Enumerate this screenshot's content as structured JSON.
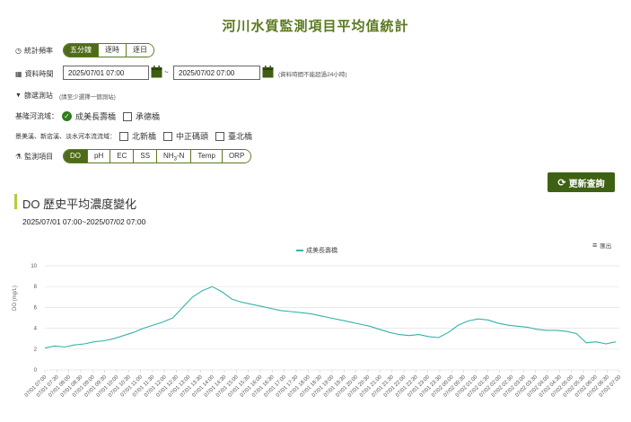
{
  "page": {
    "title": "河川水質監測項目平均值統計"
  },
  "frequency": {
    "label": "統計頻率",
    "options": [
      "五分鐘",
      "逐時",
      "逐日"
    ],
    "active": 0
  },
  "period": {
    "label": "資料時間",
    "start": "2025/07/01 07:00",
    "sep": "~",
    "end": "2025/07/02 07:00",
    "note": "(資料時間不能超過24小時)"
  },
  "stations": {
    "label": "篩選測站",
    "hint": "(請至少選擇一個測站)",
    "group1": {
      "label": "基隆河流域：",
      "items": [
        {
          "name": "成美長壽橋",
          "checked": true
        },
        {
          "name": "承德橋",
          "checked": false
        }
      ]
    },
    "group2": {
      "label": "景美溪、新店溪、淡水河本流流域：",
      "items": [
        {
          "name": "北新橋",
          "checked": false
        },
        {
          "name": "中正碼頭",
          "checked": false
        },
        {
          "name": "臺北橋",
          "checked": false
        }
      ]
    }
  },
  "items": {
    "label": "監測項目",
    "options": [
      "DO",
      "pH",
      "EC",
      "SS",
      "NH3-N",
      "Temp",
      "ORP"
    ],
    "active": 0
  },
  "refresh": {
    "label": "更新查詢"
  },
  "chart": {
    "title": "DO 歷史平均濃度變化",
    "range": "2025/07/01 07:00~2025/07/02 07:00",
    "export_label": "匯出"
  },
  "chart_data": {
    "type": "line",
    "ylabel": "DO (mg/L)",
    "ylim": [
      0,
      10
    ],
    "yticks": [
      0,
      2,
      4,
      6,
      8,
      10
    ],
    "legend": "top-center",
    "grid": true,
    "series": [
      {
        "name": "成美長壽橋",
        "color": "#34b3a8"
      }
    ],
    "x": [
      "07/01 07:00",
      "07/01 07:30",
      "07/01 08:00",
      "07/01 08:30",
      "07/01 09:00",
      "07/01 09:30",
      "07/01 10:00",
      "07/01 10:30",
      "07/01 11:00",
      "07/01 11:30",
      "07/01 12:00",
      "07/01 12:30",
      "07/01 13:00",
      "07/01 13:30",
      "07/01 14:00",
      "07/01 14:30",
      "07/01 15:00",
      "07/01 15:30",
      "07/01 16:00",
      "07/01 16:30",
      "07/01 17:00",
      "07/01 17:30",
      "07/01 18:00",
      "07/01 18:30",
      "07/01 19:00",
      "07/01 19:30",
      "07/01 20:00",
      "07/01 20:30",
      "07/01 21:00",
      "07/01 21:30",
      "07/01 22:00",
      "07/01 22:30",
      "07/01 23:00",
      "07/01 23:30",
      "07/02 00:00",
      "07/02 00:30",
      "07/02 01:00",
      "07/02 01:30",
      "07/02 02:00",
      "07/02 02:30",
      "07/02 03:00",
      "07/02 03:30",
      "07/02 04:00",
      "07/02 04:30",
      "07/02 05:00",
      "07/02 05:30",
      "07/02 06:00",
      "07/02 06:30",
      "07/02 07:00"
    ],
    "values": [
      2.1,
      2.3,
      2.2,
      2.4,
      2.5,
      2.7,
      2.8,
      3.0,
      3.3,
      3.6,
      4.0,
      4.3,
      4.6,
      5.0,
      6.0,
      7.0,
      7.6,
      8.0,
      7.5,
      6.8,
      6.5,
      6.3,
      6.1,
      5.9,
      5.7,
      5.6,
      5.5,
      5.4,
      5.2,
      5.0,
      4.8,
      4.6,
      4.4,
      4.2,
      3.9,
      3.6,
      3.4,
      3.3,
      3.4,
      3.2,
      3.1,
      3.6,
      4.3,
      4.7,
      4.9,
      4.8,
      4.5,
      4.3,
      4.2,
      4.1,
      3.9,
      3.8,
      3.8,
      3.7,
      3.5,
      2.6,
      2.7,
      2.5,
      2.7
    ]
  }
}
